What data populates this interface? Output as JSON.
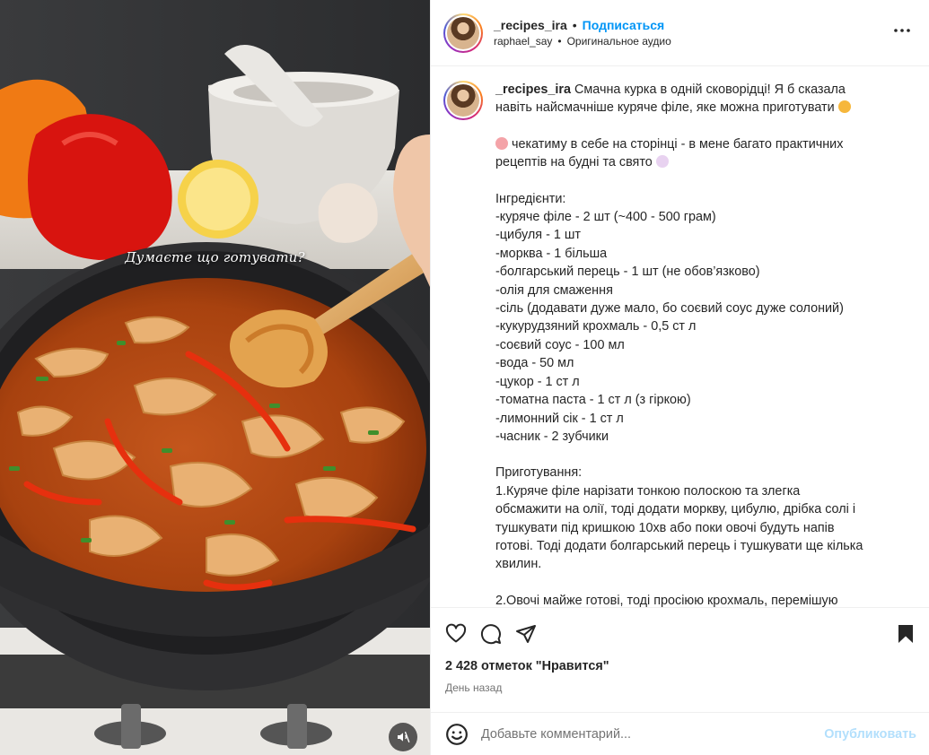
{
  "media": {
    "overlay_text": "Думаєте що готувати?",
    "mute_icon": "sound-off-icon"
  },
  "header": {
    "username": "_recipes_ira",
    "separator": "•",
    "follow_label": "Подписаться",
    "audio_author": "raphael_say",
    "audio_label": "Оригинальное аудио",
    "more_icon": "more-options-icon"
  },
  "caption": {
    "username": "_recipes_ira",
    "lines": [
      "Смачна курка в одній сковорідці! Я б сказала",
      "навіть найсмачніше куряче філе, яке можна приготувати",
      "",
      "чекатиму в себе на сторінці - в мене багато практичних",
      "рецептів на будні та свято",
      "",
      "Інгредієнти:",
      "-куряче філе - 2 шт (~400 - 500 грам)",
      "-цибуля - 1 шт",
      "-морква - 1 більша",
      "-болгарський перець - 1 шт (не обов’язково)",
      "-олія для смаження",
      "-сіль (додавати дуже мало, бо соєвий соус дуже солоний)",
      "-кукурудзяний крохмаль - 0,5 ст л",
      "-соєвий соус - 100 мл",
      "-вода - 50 мл",
      "-цукор - 1 ст л",
      "-томатна паста - 1 ст л (з гіркою)",
      "-лимонний сік - 1 ст л",
      "-часник - 2 зубчики",
      "",
      "Приготування:",
      "1.Куряче філе нарізати тонкою полоскою та злегка",
      "обсмажити на олії, тоді додати моркву, цибулю, дрібка солі і",
      "тушкувати під кришкою 10хв або поки овочі будуть напів",
      "готові. Тоді додати болгарський перець і тушкувати ще кілька",
      "хвилин.",
      "",
      "2.Овочі майже готові, тоді просіюю крохмаль, перемішую"
    ]
  },
  "actions": {
    "like_icon": "heart-icon",
    "comment_icon": "comment-icon",
    "share_icon": "share-icon",
    "save_icon": "bookmark-icon",
    "likes_text": "2 428 отметок \"Нравится\"",
    "time_text": "День назад"
  },
  "comment": {
    "emoji_icon": "emoji-icon",
    "placeholder": "Добавьте комментарий...",
    "post_label": "Опубликовать"
  },
  "colors": {
    "link_blue": "#0095f6",
    "post_disabled": "#b2dffc",
    "text": "#262626",
    "muted": "#737373",
    "divider": "#efefef"
  }
}
